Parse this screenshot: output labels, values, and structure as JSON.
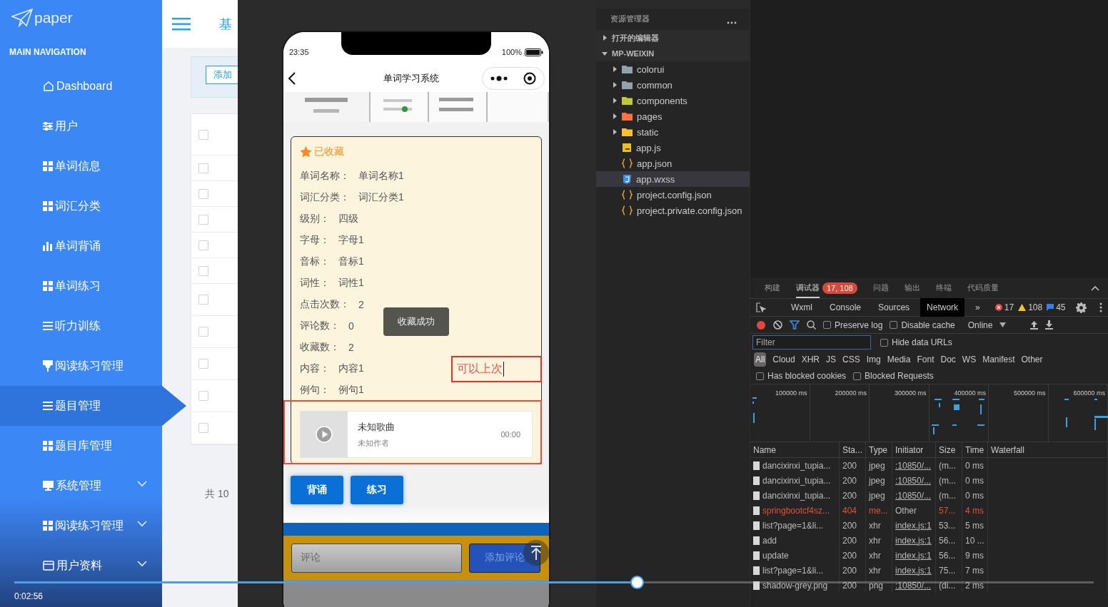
{
  "sidebar": {
    "logo": "paper",
    "section_title": "MAIN NAVIGATION",
    "items": [
      {
        "label": "Dashboard",
        "selected": false,
        "has_submenu": false
      },
      {
        "label": "用户",
        "selected": false,
        "has_submenu": false
      },
      {
        "label": "单词信息",
        "selected": false,
        "has_submenu": false
      },
      {
        "label": "词汇分类",
        "selected": false,
        "has_submenu": false
      },
      {
        "label": "单词背诵",
        "selected": false,
        "has_submenu": false
      },
      {
        "label": "单词练习",
        "selected": false,
        "has_submenu": false
      },
      {
        "label": "听力训练",
        "selected": false,
        "has_submenu": false
      },
      {
        "label": "阅读练习管理",
        "selected": false,
        "has_submenu": false
      },
      {
        "label": "题目管理",
        "selected": true,
        "has_submenu": false
      },
      {
        "label": "题目库管理",
        "selected": false,
        "has_submenu": false
      },
      {
        "label": "系统管理",
        "selected": false,
        "has_submenu": true
      },
      {
        "label": "阅读练习管理",
        "selected": false,
        "has_submenu": true
      },
      {
        "label": "用户资料",
        "selected": false,
        "has_submenu": true
      }
    ]
  },
  "admin": {
    "header_title": "基",
    "add_button": "添加",
    "header_checkbox": {
      "checked": false
    },
    "rows": [
      {
        "checked": false
      },
      {
        "checked": false
      },
      {
        "checked": false
      },
      {
        "checked": false
      },
      {
        "checked": false
      },
      {
        "checked": false
      },
      {
        "checked": false
      },
      {
        "checked": false
      },
      {
        "checked": false
      },
      {
        "checked": false
      }
    ],
    "footer": "共 10"
  },
  "phone": {
    "time": "23:35",
    "battery": "100%",
    "title": "单词学习系统",
    "card": {
      "favorite_label": "已收藏",
      "fields": [
        {
          "label": "单词名称：",
          "value": "单词名称1"
        },
        {
          "label": "词汇分类：",
          "value": "词汇分类1"
        },
        {
          "label": "级别：",
          "value": "四级"
        },
        {
          "label": "字母：",
          "value": "字母1"
        },
        {
          "label": "音标：",
          "value": "音标1"
        },
        {
          "label": "词性：",
          "value": "词性1"
        },
        {
          "label": "点击次数：",
          "value": "2"
        },
        {
          "label": "评论数：",
          "value": "0"
        },
        {
          "label": "收藏数：",
          "value": "2"
        },
        {
          "label": "内容：",
          "value": "内容1"
        },
        {
          "label": "例句：",
          "value": "例句1"
        }
      ],
      "audio": {
        "title": "未知歌曲",
        "artist": "未知作者",
        "time": "00:00"
      }
    },
    "toast": "收藏成功",
    "annotation": "可以上次",
    "buttons": [
      "背诵",
      "练习"
    ],
    "comment": {
      "placeholder": "评论",
      "button": "添加评论"
    }
  },
  "explorer": {
    "title": "资源管理器",
    "sections": [
      {
        "label": "打开的编辑器",
        "expanded": false
      },
      {
        "label": "MP-WEIXIN",
        "expanded": true,
        "children": [
          {
            "name": "colorui",
            "kind": "folder",
            "color": "#90a4ae",
            "expanded": false,
            "selected": false
          },
          {
            "name": "common",
            "kind": "folder",
            "color": "#90a4ae",
            "expanded": false,
            "selected": false
          },
          {
            "name": "components",
            "kind": "folder",
            "color": "#c0ca33",
            "expanded": false,
            "selected": false
          },
          {
            "name": "pages",
            "kind": "folder",
            "color": "#ff7043",
            "expanded": false,
            "selected": false
          },
          {
            "name": "static",
            "kind": "folder",
            "color": "#fbc02d",
            "expanded": false,
            "selected": false
          },
          {
            "name": "app.js",
            "kind": "js",
            "selected": false
          },
          {
            "name": "app.json",
            "kind": "json",
            "selected": false
          },
          {
            "name": "app.wxss",
            "kind": "css",
            "selected": true
          },
          {
            "name": "project.config.json",
            "kind": "json",
            "selected": false
          },
          {
            "name": "project.private.config.json",
            "kind": "json",
            "selected": false
          }
        ]
      }
    ]
  },
  "devtools": {
    "top_tabs": [
      {
        "label": "构建",
        "selected": false
      },
      {
        "label": "调试器",
        "selected": true,
        "badge": "17, 108"
      },
      {
        "label": "问题",
        "selected": false
      },
      {
        "label": "输出",
        "selected": false
      },
      {
        "label": "终端",
        "selected": false
      },
      {
        "label": "代码质量",
        "selected": false
      }
    ],
    "panel_tabs": [
      {
        "label": "Wxml",
        "selected": false
      },
      {
        "label": "Console",
        "selected": false
      },
      {
        "label": "Sources",
        "selected": false
      },
      {
        "label": "Network",
        "selected": true
      }
    ],
    "more_tabs": "»",
    "errors": "17",
    "warnings": "108",
    "messages": "45",
    "recording": true,
    "options": [
      {
        "label": "Preserve log",
        "checked": false
      },
      {
        "label": "Disable cache",
        "checked": false
      }
    ],
    "throttling": "Online",
    "filter": {
      "placeholder": "Filter"
    },
    "hide_data_urls": {
      "label": "Hide data URLs",
      "checked": false
    },
    "type_filters": [
      {
        "label": "All",
        "selected": true
      },
      {
        "label": "Cloud",
        "selected": false
      },
      {
        "label": "XHR",
        "selected": false
      },
      {
        "label": "JS",
        "selected": false
      },
      {
        "label": "CSS",
        "selected": false
      },
      {
        "label": "Img",
        "selected": false
      },
      {
        "label": "Media",
        "selected": false
      },
      {
        "label": "Font",
        "selected": false
      },
      {
        "label": "Doc",
        "selected": false
      },
      {
        "label": "WS",
        "selected": false
      },
      {
        "label": "Manifest",
        "selected": false
      },
      {
        "label": "Other",
        "selected": false
      }
    ],
    "blocked": [
      {
        "label": "Has blocked cookies",
        "checked": false
      },
      {
        "label": "Blocked Requests",
        "checked": false
      }
    ],
    "overview_ticks": [
      "100000 ms",
      "200000 ms",
      "300000 ms",
      "400000 ms",
      "500000 ms",
      "600000 ms"
    ],
    "columns": [
      "Name",
      "Sta...",
      "Type",
      "Initiator",
      "Size",
      "Time",
      "Waterfall"
    ],
    "rows": [
      {
        "name": "dancixinxi_tupia...",
        "status": "200",
        "type": "jpeg",
        "initiator": ":10850/...",
        "size": "(m...",
        "time": "0 ms",
        "failed": false
      },
      {
        "name": "dancixinxi_tupia...",
        "status": "200",
        "type": "jpeg",
        "initiator": ":10850/...",
        "size": "(m...",
        "time": "0 ms",
        "failed": false
      },
      {
        "name": "dancixinxi_tupia...",
        "status": "200",
        "type": "jpeg",
        "initiator": ":10850/...",
        "size": "(m...",
        "time": "0 ms",
        "failed": false
      },
      {
        "name": "springbootcf4sz...",
        "status": "404",
        "type": "me...",
        "initiator": "Other",
        "size": "57...",
        "time": "4 ms",
        "failed": true
      },
      {
        "name": "list?page=1&li...",
        "status": "200",
        "type": "xhr",
        "initiator": "index.js:1",
        "size": "53...",
        "time": "5 ms",
        "failed": false
      },
      {
        "name": "add",
        "status": "200",
        "type": "xhr",
        "initiator": "index.js:1",
        "size": "56...",
        "time": "10 ...",
        "failed": false
      },
      {
        "name": "update",
        "status": "200",
        "type": "xhr",
        "initiator": "index.js:1",
        "size": "56...",
        "time": "9 ms",
        "failed": false
      },
      {
        "name": "list?page=1&li...",
        "status": "200",
        "type": "xhr",
        "initiator": "index.js:1",
        "size": "75...",
        "time": "7 ms",
        "failed": false
      },
      {
        "name": "shadow-grey.png",
        "status": "200",
        "type": "png",
        "initiator": ":10850/...",
        "size": "(di...",
        "time": "2 ms",
        "failed": false
      }
    ]
  },
  "video": {
    "progress": {
      "level": 0.571
    },
    "time": "0:02:56"
  }
}
